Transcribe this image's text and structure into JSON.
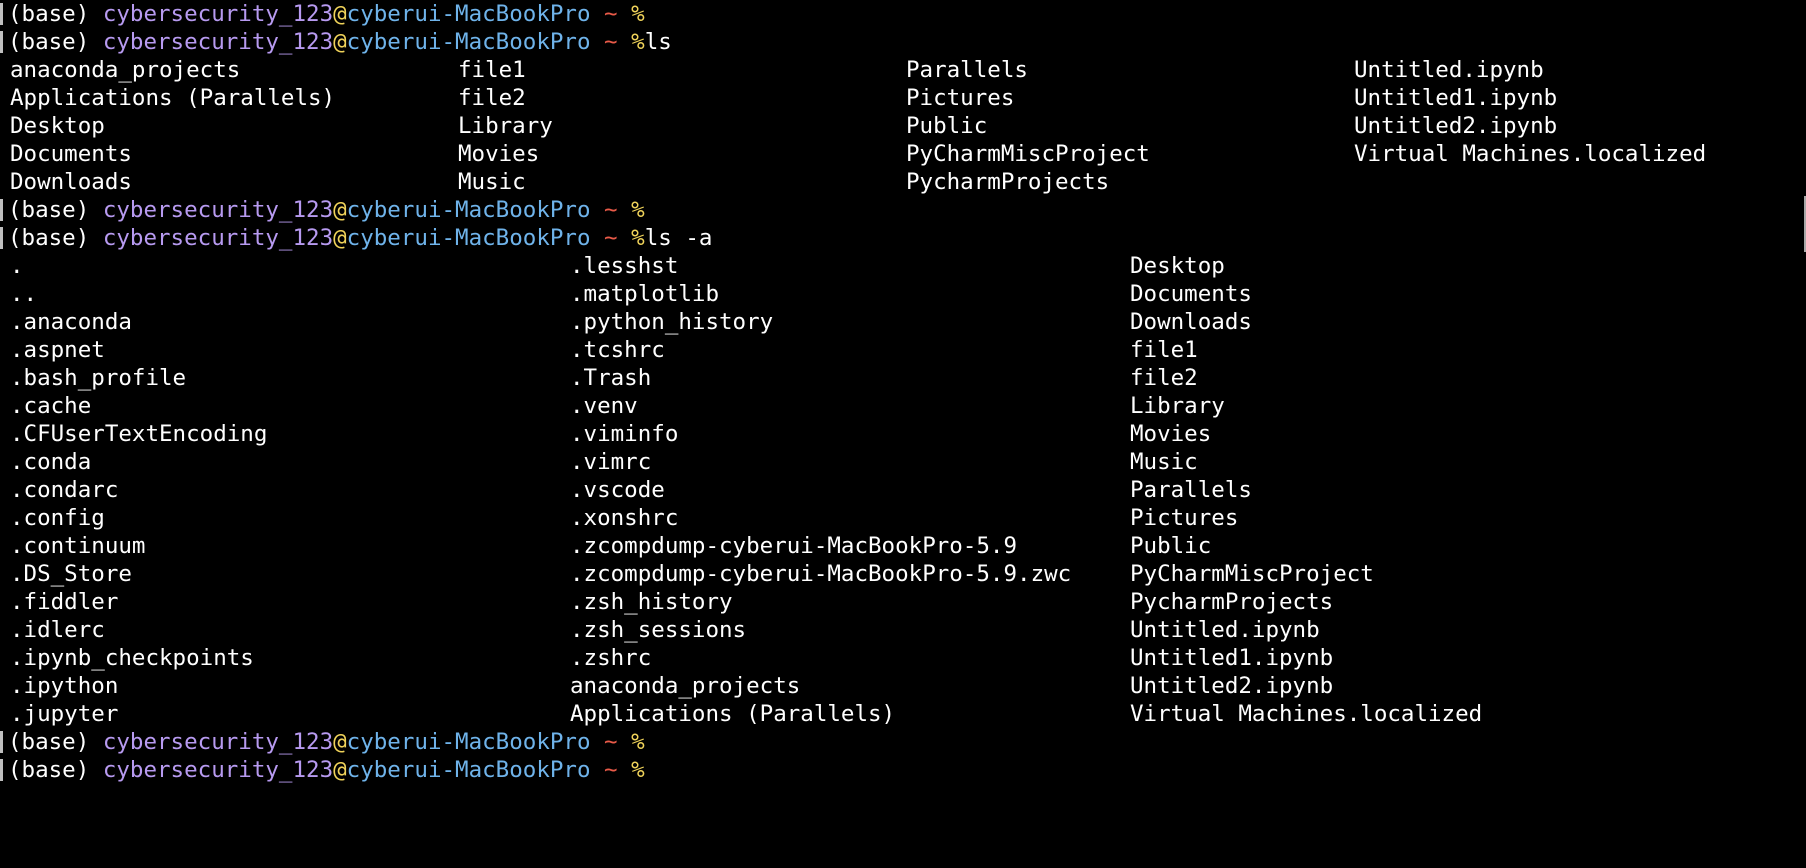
{
  "colors": {
    "background": "#000000",
    "text": "#ffffff",
    "user": "#b79af0",
    "at": "#f0d35a",
    "host": "#6fb3ea",
    "tilde": "#e95a48",
    "percent": "#f0d35a"
  },
  "prompt": {
    "env": "(base) ",
    "user": "cybersecurity_123",
    "at": "@",
    "host": "cyberui-MacBookPro",
    "tilde": " ~ ",
    "symbol": "%"
  },
  "commands": {
    "ls": "ls",
    "ls_a": "ls -a"
  },
  "ls_output": [
    [
      "anaconda_projects",
      "file1",
      "Parallels",
      "Untitled.ipynb"
    ],
    [
      "Applications (Parallels)",
      "file2",
      "Pictures",
      "Untitled1.ipynb"
    ],
    [
      "Desktop",
      "Library",
      "Public",
      "Untitled2.ipynb"
    ],
    [
      "Documents",
      "Movies",
      "PyCharmMiscProject",
      "Virtual Machines.localized"
    ],
    [
      "Downloads",
      "Music",
      "PycharmProjects",
      ""
    ]
  ],
  "ls_a_output": [
    [
      ".",
      ".lesshst",
      "Desktop"
    ],
    [
      "..",
      ".matplotlib",
      "Documents"
    ],
    [
      ".anaconda",
      ".python_history",
      "Downloads"
    ],
    [
      ".aspnet",
      ".tcshrc",
      "file1"
    ],
    [
      ".bash_profile",
      ".Trash",
      "file2"
    ],
    [
      ".cache",
      ".venv",
      "Library"
    ],
    [
      ".CFUserTextEncoding",
      ".viminfo",
      "Movies"
    ],
    [
      ".conda",
      ".vimrc",
      "Music"
    ],
    [
      ".condarc",
      ".vscode",
      "Parallels"
    ],
    [
      ".config",
      ".xonshrc",
      "Pictures"
    ],
    [
      ".continuum",
      ".zcompdump-cyberui-MacBookPro-5.9",
      "Public"
    ],
    [
      ".DS_Store",
      ".zcompdump-cyberui-MacBookPro-5.9.zwc",
      "PyCharmMiscProject"
    ],
    [
      ".fiddler",
      ".zsh_history",
      "PycharmProjects"
    ],
    [
      ".idlerc",
      ".zsh_sessions",
      "Untitled.ipynb"
    ],
    [
      ".ipynb_checkpoints",
      ".zshrc",
      "Untitled1.ipynb"
    ],
    [
      ".ipython",
      "anaconda_projects",
      "Untitled2.ipynb"
    ],
    [
      ".jupyter",
      "Applications (Parallels)",
      "Virtual Machines.localized"
    ]
  ]
}
